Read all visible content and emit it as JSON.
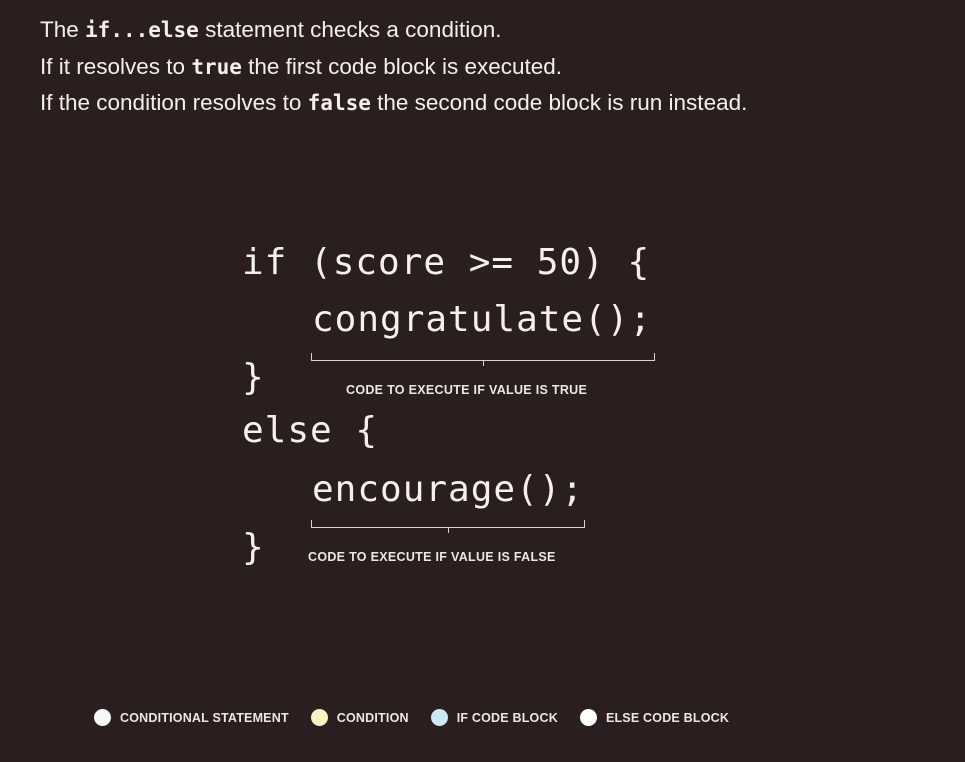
{
  "intro": {
    "line1": {
      "pre": "The ",
      "code": "if...else",
      "post": " statement checks a condition."
    },
    "line2": {
      "pre": "If it resolves to ",
      "code": "true",
      "post": " the first code block is executed."
    },
    "line3": {
      "pre": "If the condition resolves to ",
      "code": "false",
      "post": " the second code block is run instead."
    }
  },
  "code": {
    "line1": "if (score >= 50) {",
    "line2": "congratulate();",
    "line3": "}",
    "line4": "else {",
    "line5": "encourage();",
    "line6": "}"
  },
  "annotations": {
    "true_block": "CODE TO EXECUTE IF VALUE IS TRUE",
    "false_block": "CODE TO EXECUTE IF VALUE IS FALSE"
  },
  "legend": [
    {
      "label": "CONDITIONAL STATEMENT",
      "color": "#f7f7f7"
    },
    {
      "label": "CONDITION",
      "color": "#fbefc4"
    },
    {
      "label": "IF CODE BLOCK",
      "color": "#cbe9f2"
    },
    {
      "label": "ELSE CODE BLOCK",
      "color": "#ffffff"
    }
  ]
}
